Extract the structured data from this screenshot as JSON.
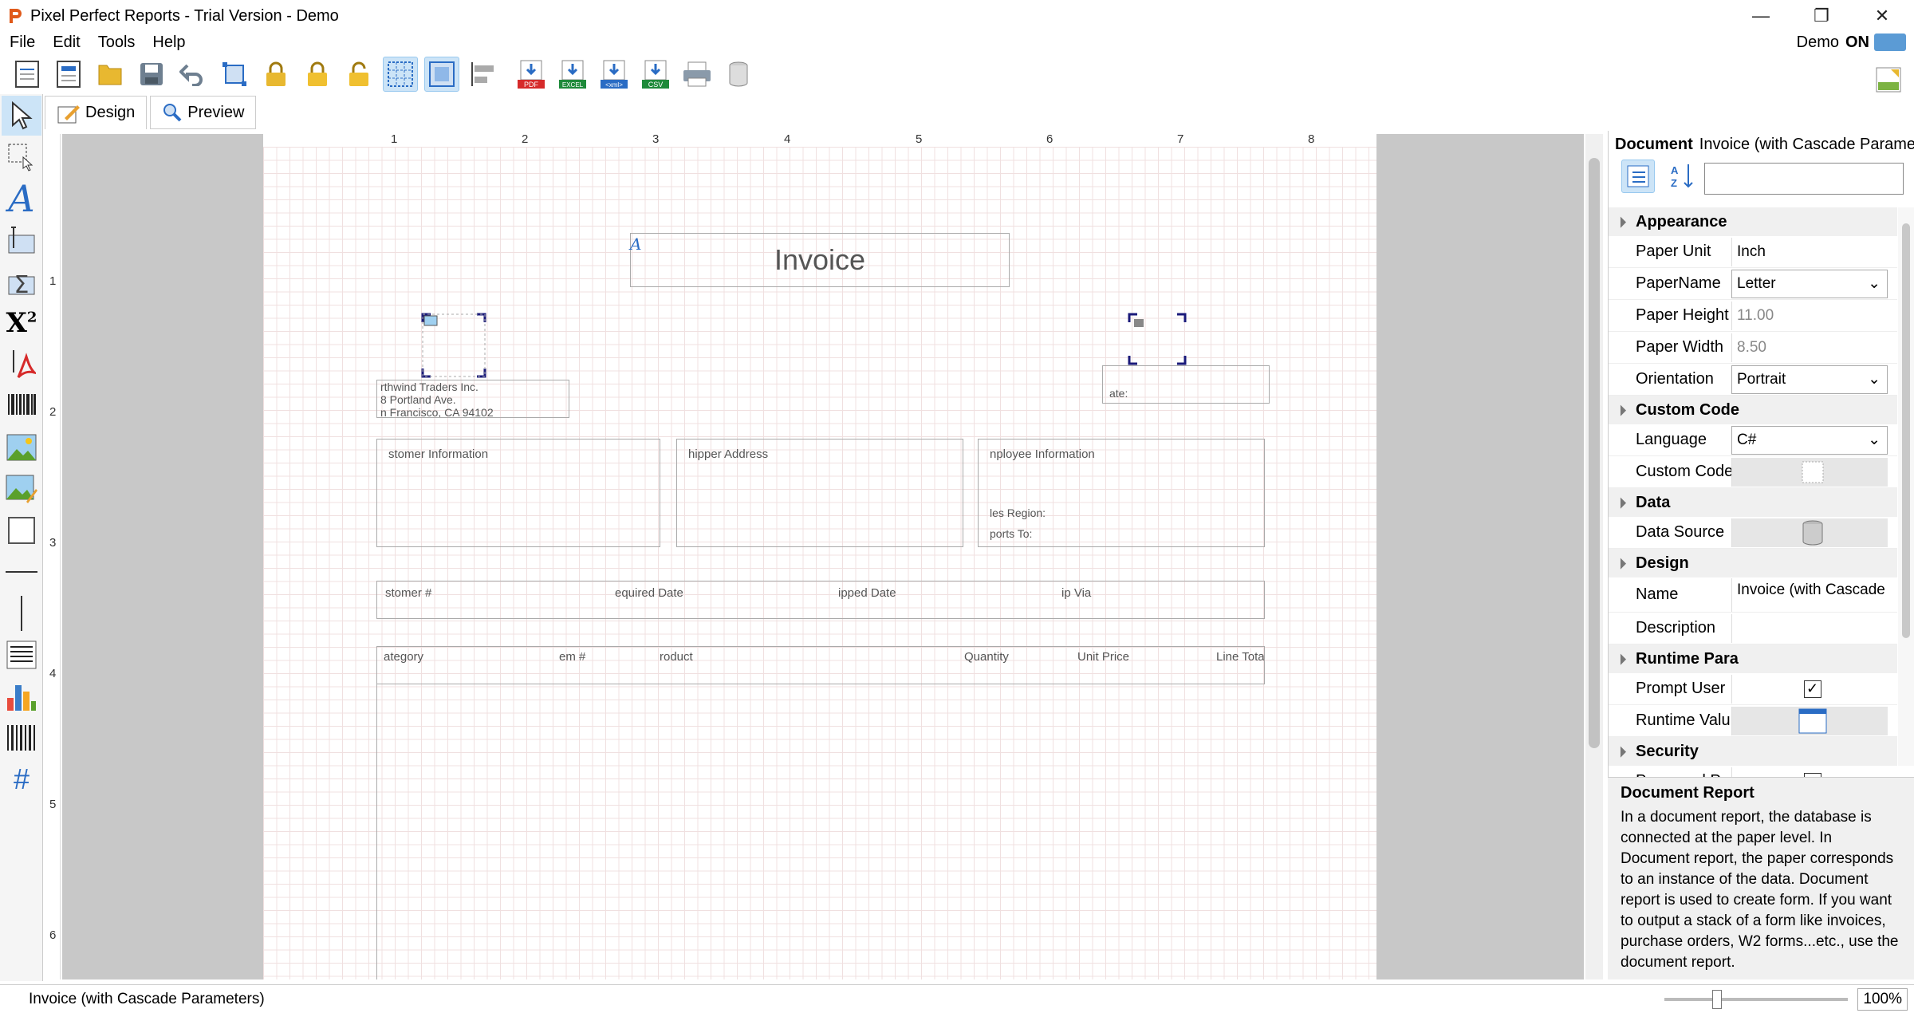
{
  "window": {
    "title": "Pixel Perfect Reports - Trial Version - Demo"
  },
  "menu": [
    "File",
    "Edit",
    "Tools",
    "Help"
  ],
  "demo": {
    "label": "Demo",
    "state": "ON"
  },
  "toolbar": {
    "icons": [
      "new-report-icon",
      "new-document-icon",
      "open-folder-icon",
      "save-icon",
      "undo-icon",
      "resize-icon",
      "lock-all-icon",
      "lock-icon",
      "unlock-icon",
      "grid-icon",
      "snap-grid-icon",
      "align-icon",
      "export-pdf-icon",
      "export-excel-icon",
      "export-xml-icon",
      "export-csv-icon",
      "print-icon",
      "database-icon"
    ],
    "export_labels": {
      "pdf": "PDF",
      "excel": "EXCEL",
      "xml": "<xml>",
      "csv": "CSV"
    }
  },
  "tabs": {
    "design": "Design",
    "preview": "Preview"
  },
  "ruler": {
    "h": [
      "1",
      "2",
      "3",
      "4",
      "5",
      "6",
      "7",
      "8"
    ],
    "v": [
      "1",
      "2",
      "3",
      "4",
      "5",
      "6"
    ]
  },
  "report": {
    "title": "Invoice",
    "company": [
      "rthwind Traders Inc.",
      "8 Portland Ave.",
      "n Francisco, CA 94102"
    ],
    "date_label": "ate:",
    "sections": {
      "customer": "stomer Information",
      "shipper": "hipper Address",
      "employee": "nployee Information",
      "sales_region": "les Region:",
      "reports_to": "ports To:"
    },
    "order_header": [
      "stomer #",
      "equired Date",
      "ipped Date",
      "ip Via"
    ],
    "detail_header": [
      "ategory",
      "em #",
      "roduct",
      "Quantity",
      "Unit Price",
      "Line Tota"
    ]
  },
  "properties": {
    "doc_label": "Document",
    "doc_name": "Invoice (with Cascade Paramete",
    "categories": {
      "appearance": "Appearance",
      "custom_code": "Custom Code",
      "data": "Data",
      "design": "Design",
      "runtime": "Runtime Para",
      "security": "Security"
    },
    "rows": {
      "paper_unit": {
        "k": "Paper Unit",
        "v": "Inch"
      },
      "paper_name": {
        "k": "PaperName",
        "v": "Letter"
      },
      "paper_height": {
        "k": "Paper Height",
        "v": "11.00"
      },
      "paper_width": {
        "k": "Paper Width",
        "v": "8.50"
      },
      "orientation": {
        "k": "Orientation",
        "v": "Portrait"
      },
      "language": {
        "k": "Language",
        "v": "C#"
      },
      "custom_code": {
        "k": "Custom Code",
        "v": ""
      },
      "data_source": {
        "k": "Data Source",
        "v": ""
      },
      "name": {
        "k": "Name",
        "v": "Invoice (with Cascade"
      },
      "description": {
        "k": "Description",
        "v": ""
      },
      "prompt_user": {
        "k": "Prompt User",
        "v": "✓"
      },
      "runtime_value": {
        "k": "Runtime Valu",
        "v": ""
      },
      "password": {
        "k": "Password Pro",
        "v": ""
      }
    }
  },
  "description": {
    "title": "Document Report",
    "body": "In a document report, the database is connected at the paper level. In Document report, the paper corresponds to an instance of the data. Document report is used to create form. If you want to output a stack of a form like invoices, purchase orders, W2 forms...etc., use the document report."
  },
  "status": {
    "text": "Invoice (with Cascade Parameters)",
    "zoom": "100%"
  }
}
